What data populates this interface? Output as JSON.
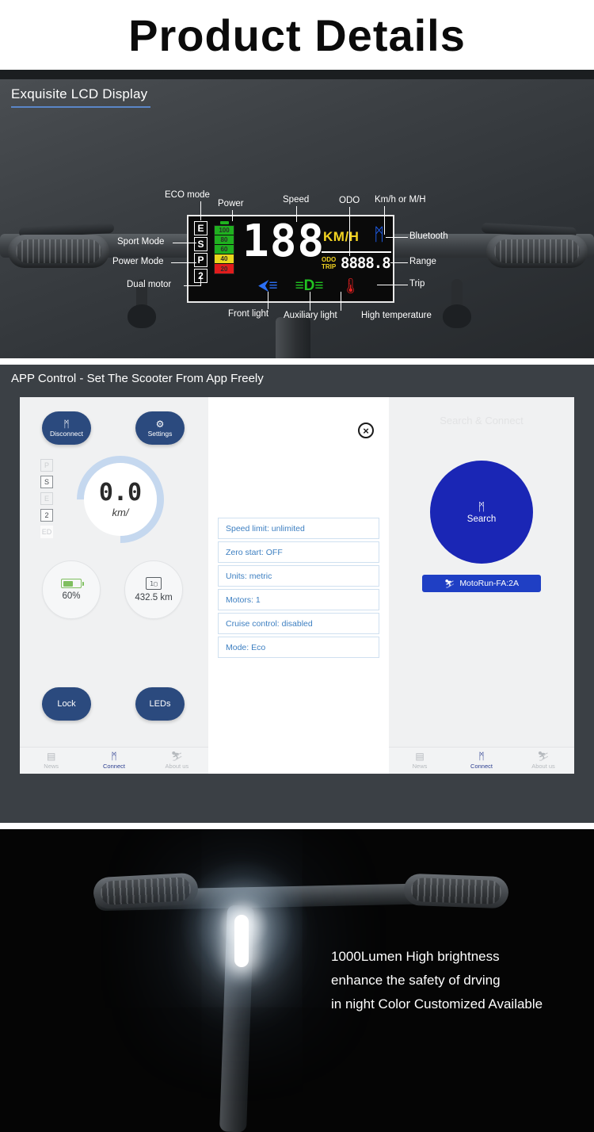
{
  "banner": {
    "title": "Product Details"
  },
  "lcd_section": {
    "heading": "Exquisite LCD Display",
    "callouts": {
      "eco_mode": "ECO mode",
      "power": "Power",
      "speed": "Speed",
      "odo": "ODO",
      "unit_switch": "Km/h or M/H",
      "sport_mode": "Sport Mode",
      "power_mode": "Power Mode",
      "dual_motor": "Dual motor",
      "bluetooth": "Bluetooth",
      "range": "Range",
      "trip": "Trip",
      "front_light": "Front light",
      "auxiliary_light": "Auxiliary light",
      "high_temperature": "High temperature"
    },
    "display": {
      "modes": [
        "E",
        "S",
        "P",
        "2"
      ],
      "battery_levels": [
        "100",
        "80",
        "60",
        "40",
        "20"
      ],
      "battery_colors": [
        "#1fb01f",
        "#1fb01f",
        "#1fb01f",
        "#e8d71c",
        "#e01c1c"
      ],
      "speed_value": "188",
      "unit": "KM/H",
      "bluetooth_glyph": "ᛗ",
      "odo_label": "ODO",
      "trip_label": "TRIP",
      "odo_value": "8888.8",
      "front_light_glyph": "⮜≡",
      "aux_light_glyph": "≡D≡",
      "temp_glyph": "ⸯ"
    }
  },
  "app_section": {
    "heading": "APP Control - Set The Scooter From App Freely",
    "left_panel": {
      "top_buttons": [
        {
          "label": "Disconnect",
          "icon": "bluetooth-icon",
          "glyph": "ᛗ"
        },
        {
          "label": "Settings",
          "icon": "gear-icon",
          "glyph": "⚙"
        }
      ],
      "mode_indicators": [
        {
          "label": "P",
          "active": false
        },
        {
          "label": "S",
          "active": true
        },
        {
          "label": "E",
          "active": false
        },
        {
          "label": "2",
          "active": true
        },
        {
          "label": "ED",
          "active": false
        }
      ],
      "gauge": {
        "value": "0.0",
        "unit": "km/"
      },
      "stats": [
        {
          "icon": "battery-icon",
          "value": "60%"
        },
        {
          "icon": "odometer-icon",
          "value": "432.5 km"
        }
      ],
      "bottom_buttons": [
        {
          "label": "Lock"
        },
        {
          "label": "LEDs"
        }
      ]
    },
    "middle_panel": {
      "close_icon": "close-circle-icon",
      "settings": [
        "Speed limit: unlimited",
        "Zero start: OFF",
        "Units: metric",
        "Motors: 1",
        "Cruise control: disabled",
        "Mode: Eco"
      ]
    },
    "right_panel": {
      "title": "Search & Connect",
      "search_button": {
        "label": "Search",
        "glyph": "ᛗ"
      },
      "device": {
        "label": "MotoRun-FA:2A",
        "glyph": "⛷"
      }
    },
    "tabbar": [
      {
        "label": "News",
        "glyph": "▤",
        "active": false
      },
      {
        "label": "Connect",
        "glyph": "ᛗ",
        "active": true
      },
      {
        "label": "About us",
        "glyph": "⛷",
        "active": false
      }
    ]
  },
  "light_section": {
    "lines": [
      "1000Lumen High brightness",
      "enhance the safety of drving",
      "in night Color Customized Available"
    ]
  },
  "colors": {
    "accent_blue": "#5a86c8",
    "header_gray": "#3b4045",
    "app_navy": "#2b4a7e",
    "search_blue": "#1a26b5",
    "setting_text": "#3d7fc1"
  }
}
